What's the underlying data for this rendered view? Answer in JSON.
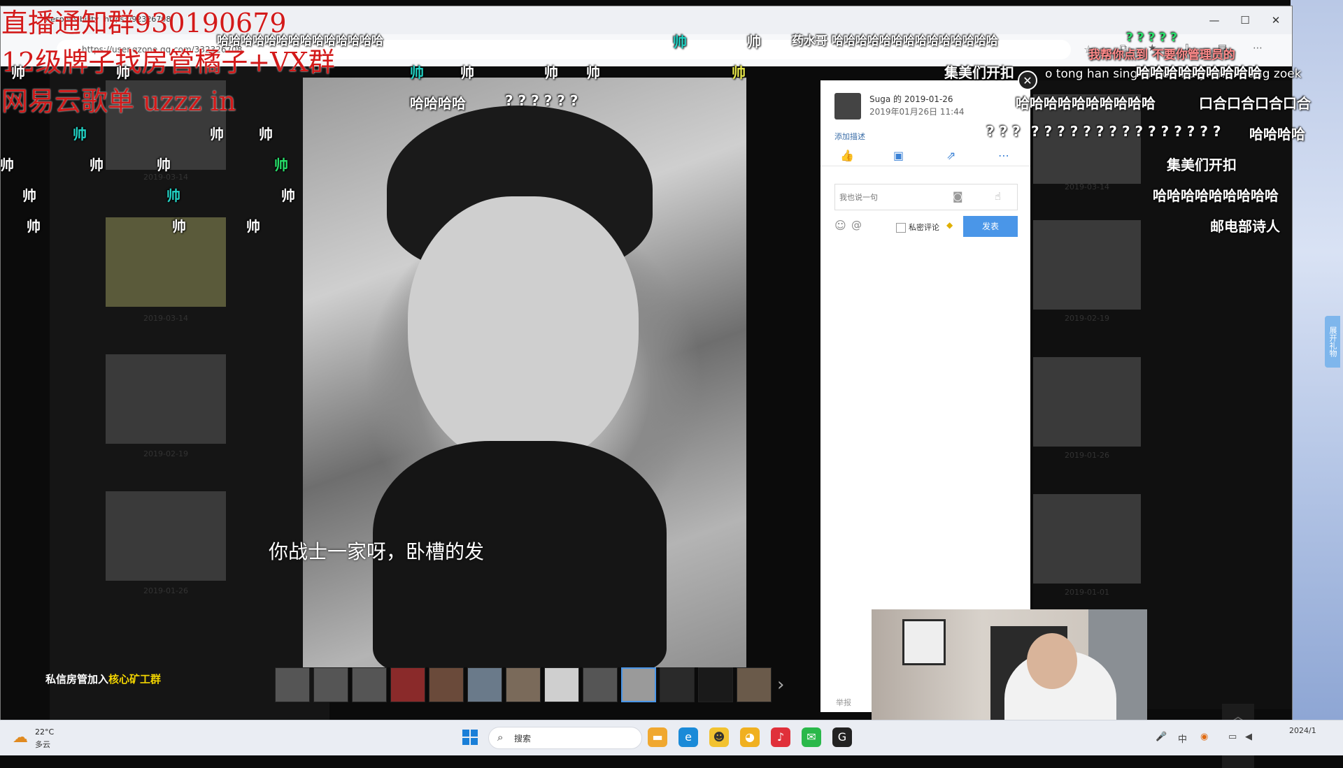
{
  "browser": {
    "tab_title": "Responsibility",
    "tab_url": "https://92326708",
    "url": "https://user.qzone.qq.com/332326708",
    "window_controls": [
      "—",
      "☐",
      "✕"
    ]
  },
  "photo_viewer": {
    "author": "Suga 的 2019-01-26",
    "timestamp": "2019年01月26日 11:44",
    "add_description": "添加描述",
    "comment_placeholder": "我也说一句",
    "private_comment": "私密评论",
    "publish": "发表",
    "report": "举报",
    "subtitle": "你战士一家呀，卧槽的发"
  },
  "sidebar_dates": [
    "2019-03-14",
    "2019-03-14",
    "2019-02-19",
    "2019-01-26"
  ],
  "right_dates": [
    "2019-03-14",
    "2019-02-19",
    "2019-01-26",
    "2019-01-01"
  ],
  "recruit": {
    "prefix": "私信房管加入",
    "highlight": "核心矿工群"
  },
  "overlay": {
    "line1": "直播通知群930190679",
    "line2": "12级牌子找房管橘子+VX群",
    "line3": "网易云歌单 uzzz in"
  },
  "danmaku": {
    "shuai": "帅",
    "haha_long": "哈哈哈哈哈哈哈哈哈哈哈哈哈哈",
    "haha4": "哈哈哈哈",
    "question6": "? ? ? ? ? ?",
    "question_long": "? ? ? ? ? ? ? ? ? ? ? ? ? ? ?",
    "jimei": "集美们开扣",
    "yaoshuige": "药水哥 哈哈哈哈哈哈哈哈哈哈哈哈哈哈",
    "otong": "o tong han sing si dou ba yi min hung zoek",
    "haha_mid": "哈哈哈哈哈哈哈哈哈哈",
    "kouhe": "口合口合口合口合",
    "haha_pink": "我帮你点到 不要你管理员的",
    "haha_right": "哈哈哈哈哈哈哈哈哈",
    "youdian": "邮电部诗人",
    "haha_q": "? ? ?",
    "question3": "? ? ? ? ?"
  },
  "gift_tab": "展开礼物",
  "taskbar": {
    "temp": "22°C",
    "condition": "多云",
    "search": "搜索",
    "clock_time": "2024/1",
    "ime": "中"
  },
  "colors": {
    "accent": "#4a96e8",
    "danmaku_cyan": "#22d3c5",
    "overlay_red": "#d31a1a"
  }
}
